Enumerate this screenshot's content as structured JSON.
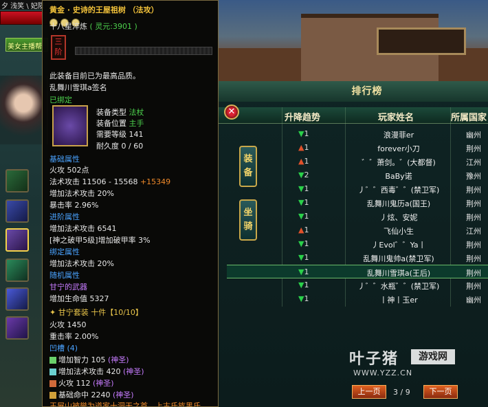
{
  "topbar": {
    "text": "夕 浅笑 \\ 妃陨"
  },
  "anchor_button": "美女主播帮",
  "tooltip": {
    "title": "黄金 · 史诗的王屋祖树 （法攻）",
    "stars_prefix": "十八星淬炼",
    "lingyuan": "( 灵元:3901 )",
    "tier": "三阶",
    "max_quality": "此装备目前已为最高品质。",
    "signed": "乱舞川雪琪a签名",
    "bound": "已绑定",
    "equip_type_label": "装备类型",
    "equip_type_value": "法杖",
    "equip_pos_label": "装备位置",
    "equip_pos_value": "主手",
    "req_level": "需要等级 141",
    "durability": "耐久度 0 / 60",
    "base_header": "基础属性",
    "fire_attack": "火攻 502点",
    "magic_attack": "法术攻击 11506 - 15568",
    "magic_attack_bonus": "+15349",
    "magic_attack_pct": "增加法术攻击 20%",
    "crit": "暴击率  2.96%",
    "advanced_header": "进阶属性",
    "adv_magic": "增加法术攻击 6541",
    "adv_break": "[神之破甲5级]增加破甲率 3%",
    "bound_header": "绑定属性",
    "bound_magic": "增加法术攻击 20%",
    "random_header": "随机属性",
    "random_weapon": "甘宁的武器",
    "random_hp": "增加生命值 5327",
    "set_name": "甘宁套装",
    "set_count": "十件【10/10】",
    "set_fire": "火攻 1450",
    "set_crit": "重击率 2.00%",
    "slots_header": "凹槽",
    "slots_count": "(4)",
    "gems": [
      {
        "text": "增加智力 105",
        "tag": "(神圣)"
      },
      {
        "text": "增加法术攻击 420",
        "tag": "(神圣)"
      },
      {
        "text": "火攻 112",
        "tag": "(神圣)"
      },
      {
        "text": "基础命中 2240",
        "tag": "(神圣)"
      }
    ],
    "footer": "王屋山被誉为道家十洞天之首，上古氏族黑氏"
  },
  "ranking": {
    "title": "排行榜",
    "columns": {
      "trend": "升降趋势",
      "player": "玩家姓名",
      "country": "所属国家"
    },
    "tabs": [
      "装备",
      "坐骑"
    ],
    "rows": [
      {
        "trend": "down",
        "n": "1",
        "name": "浪漫菲er",
        "country": "幽州"
      },
      {
        "trend": "up",
        "n": "1",
        "name": "forever小刀",
        "country": "荆州"
      },
      {
        "trend": "up",
        "n": "1",
        "name": "゛゛萧剑。゛(大都督)",
        "country": "江州"
      },
      {
        "trend": "down",
        "n": "2",
        "name": "BaBy诺",
        "country": "豫州"
      },
      {
        "trend": "down",
        "n": "1",
        "name": "丿゛゛西毒゛゛(禁卫军)",
        "country": "荆州"
      },
      {
        "trend": "down",
        "n": "1",
        "name": "乱舞川鬼历a(国王)",
        "country": "荆州"
      },
      {
        "trend": "down",
        "n": "1",
        "name": "丿炫、安妮",
        "country": "荆州"
      },
      {
        "trend": "up",
        "n": "1",
        "name": "飞仙小生",
        "country": "江州"
      },
      {
        "trend": "down",
        "n": "1",
        "name": "丿Evol゛゛Ya丨",
        "country": "荆州"
      },
      {
        "trend": "down",
        "n": "1",
        "name": "乱舞川鬼帅a(禁卫军)",
        "country": "荆州"
      },
      {
        "trend": "down",
        "n": "1",
        "name": "乱舞川雪琪a(王后)",
        "country": "荆州"
      },
      {
        "trend": "down",
        "n": "1",
        "name": "丿゛゛水瓶゛゛(禁卫军)",
        "country": "荆州"
      },
      {
        "trend": "down",
        "n": "1",
        "name": "丨神丨玉er",
        "country": "幽州"
      }
    ],
    "prev": "上一页",
    "next": "下一页",
    "page": "3 / 9"
  },
  "watermark": {
    "main": "叶子猪",
    "box": "游戏网",
    "url": "WWW.YZZ.CN"
  },
  "colors": {
    "gold": "#f3c23a",
    "blue": "#4aa3ff",
    "green": "#4cd04c"
  }
}
